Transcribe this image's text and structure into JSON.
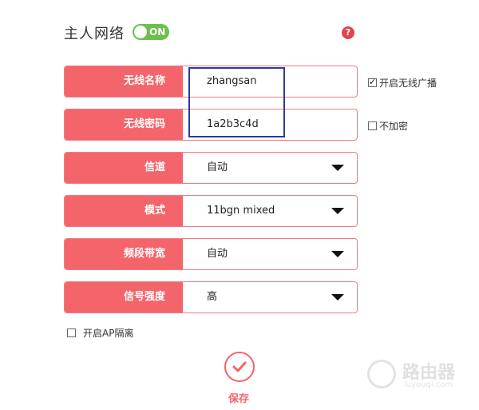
{
  "header": {
    "title": "主人网络",
    "toggle_label": "ON",
    "help_symbol": "?"
  },
  "fields": [
    {
      "label": "无线名称",
      "value": "zhangsan",
      "type": "input"
    },
    {
      "label": "无线密码",
      "value": "1a2b3c4d",
      "type": "input"
    },
    {
      "label": "信道",
      "value": "自动",
      "type": "select"
    },
    {
      "label": "模式",
      "value": "11bgn mixed",
      "type": "select"
    },
    {
      "label": "频段带宽",
      "value": "自动",
      "type": "select"
    },
    {
      "label": "信号强度",
      "value": "高",
      "type": "select"
    }
  ],
  "checkboxes": {
    "broadcast": {
      "label": "开启无线广播",
      "checked": true
    },
    "no_encrypt": {
      "label": "不加密",
      "checked": false
    },
    "ap_isolation": {
      "label": "开启AP隔离",
      "checked": false
    }
  },
  "save_label": "保存",
  "watermark": {
    "main": "路由器",
    "sub": "luyouqi.com"
  },
  "colors": {
    "accent": "#f3656b",
    "toggle": "#6cc04a",
    "help": "#e0454f",
    "highlight_box": "#2b3a9a"
  }
}
